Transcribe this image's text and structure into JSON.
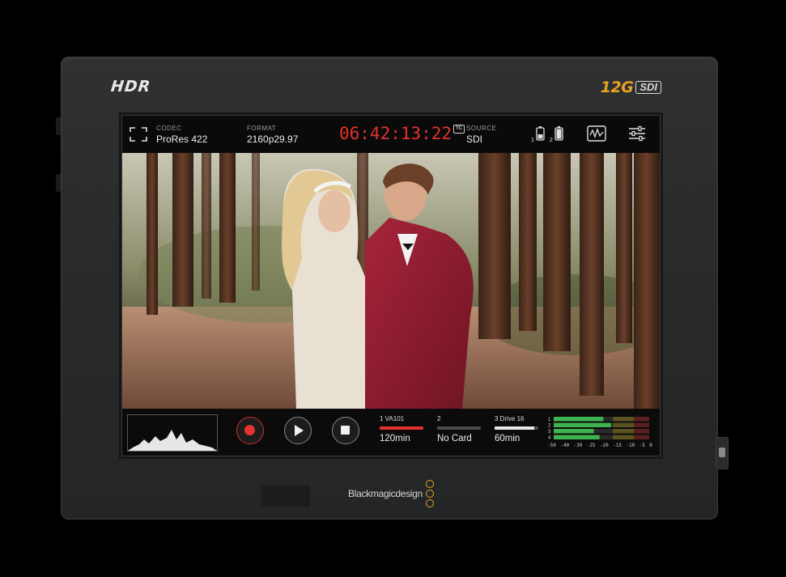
{
  "device": {
    "hdr_logo": "HDR",
    "sdi_logo_prefix": "12G",
    "sdi_logo_suffix": "SDI",
    "brand": "Blackmagicdesign"
  },
  "topbar": {
    "codec_label": "CODEC",
    "codec_value": "ProRes 422",
    "format_label": "FORMAT",
    "format_value": "2160p29.97",
    "timecode": "06:42:13:22",
    "tc_badge": "TC",
    "source_label": "SOURCE",
    "source_value": "SDI",
    "battery1_label": "1",
    "battery2_label": "2",
    "icons": [
      "fullscreen-icon",
      "battery-icon",
      "waveform-scope-icon",
      "settings-sliders-icon"
    ]
  },
  "bottombar": {
    "slots": [
      {
        "label": "1  VA101",
        "value": "120min",
        "fill": 1.0,
        "color": "#e0312e"
      },
      {
        "label": "2",
        "value": "No Card",
        "fill": 0.0,
        "color": "#4a4a4a"
      },
      {
        "label": "3  Drive 16",
        "value": "60min",
        "fill": 0.9,
        "color": "#e8e8e8"
      }
    ],
    "meter_channel_labels": [
      "1",
      "2",
      "3",
      "4"
    ],
    "meter_scale": [
      "-50",
      "-40",
      "-30",
      "-25",
      "-20",
      "-15",
      "-10",
      "-5",
      "0"
    ],
    "meter_levels": [
      0.52,
      0.6,
      0.42,
      0.48
    ],
    "colors": {
      "record": "#e53232",
      "timecode": "#e4312e",
      "meter_green": "#3fb34f",
      "accent": "#e8a31e"
    }
  }
}
